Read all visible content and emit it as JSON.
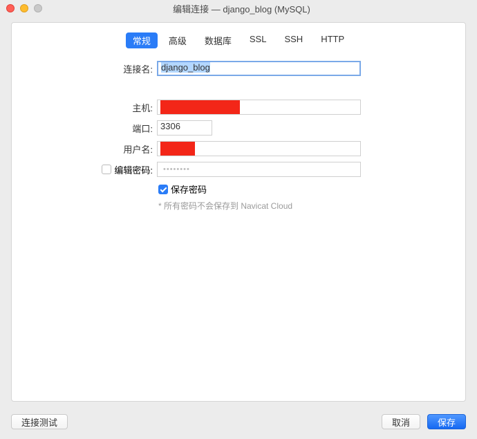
{
  "window": {
    "title": "编辑连接 — django_blog (MySQL)"
  },
  "tabs": {
    "general": "常规",
    "advanced": "高级",
    "database": "数据库",
    "ssl": "SSL",
    "ssh": "SSH",
    "http": "HTTP"
  },
  "form": {
    "conn_name_label": "连接名:",
    "conn_name_value": "django_blog",
    "host_label": "主机:",
    "port_label": "端口:",
    "port_value": "3306",
    "username_label": "用户名:",
    "edit_pw_label": "编辑密码:",
    "pw_placeholder": "••••••••",
    "save_pw_label": "保存密码",
    "hint": "* 所有密码不会保存到 Navicat Cloud"
  },
  "footer": {
    "test": "连接测试",
    "cancel": "取消",
    "save": "保存"
  }
}
